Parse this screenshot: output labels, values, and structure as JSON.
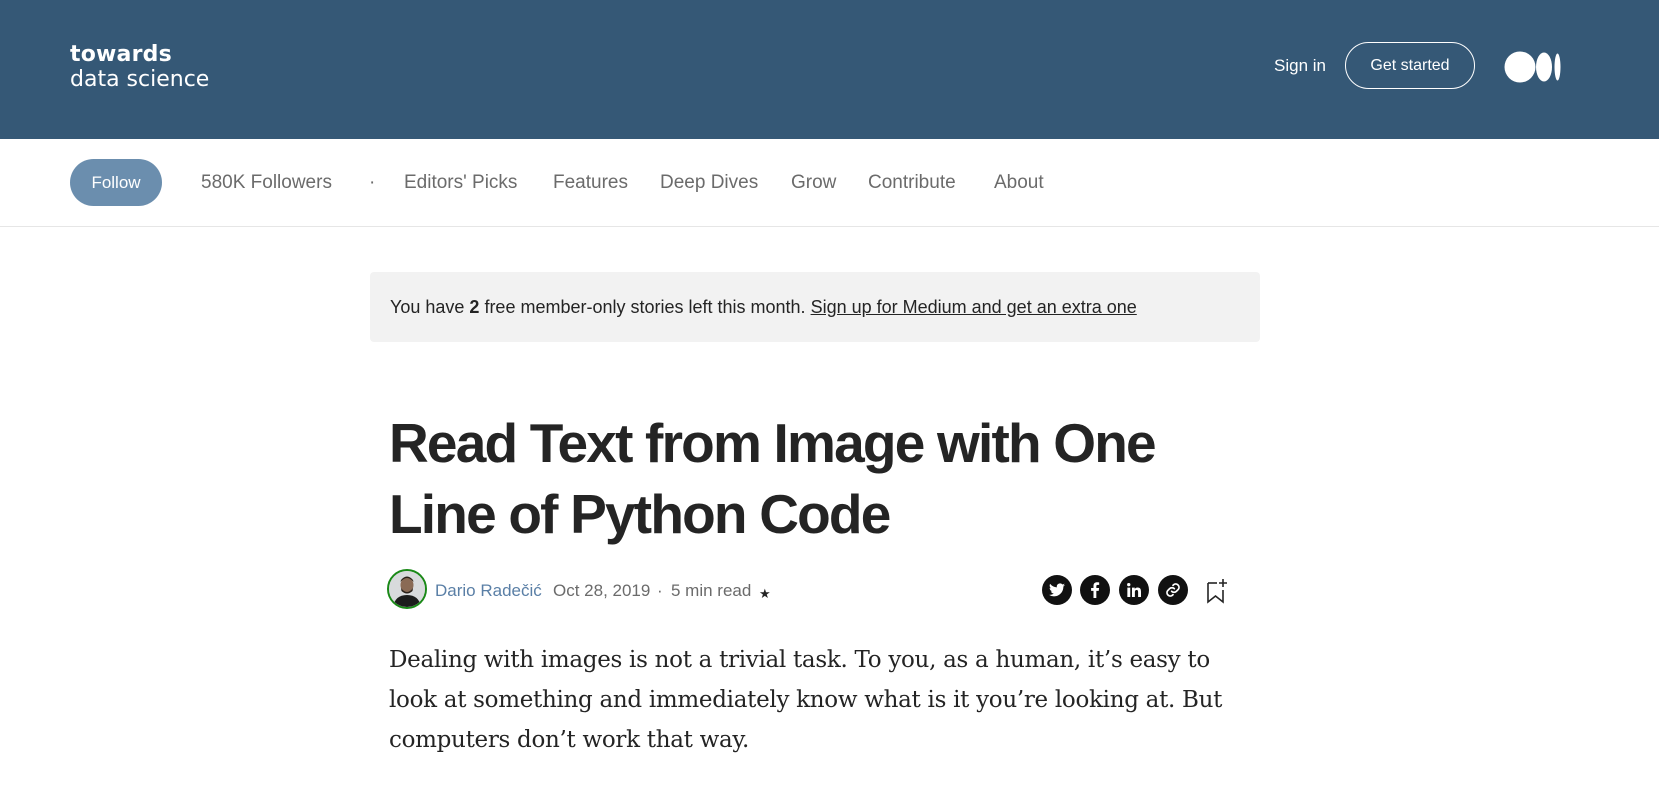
{
  "header": {
    "logo_line1": "towards",
    "logo_line2": "data science",
    "sign_in": "Sign in",
    "get_started": "Get started",
    "medium_icon": "medium-logo-icon"
  },
  "subnav": {
    "follow": "Follow",
    "followers": "580K Followers",
    "separator": "·",
    "items": [
      "Editors' Picks",
      "Features",
      "Deep Dives",
      "Grow",
      "Contribute",
      "About"
    ]
  },
  "banner": {
    "prefix": "You have ",
    "count": "2",
    "suffix": " free member-only stories left this month. ",
    "link": "Sign up for Medium and get an extra one"
  },
  "article": {
    "title": "Read Text from Image with One Line of Python Code",
    "author": "Dario Radečić",
    "date": "Oct 28, 2019",
    "dot": "·",
    "read_time": "5 min read",
    "star": "★",
    "share_icons": [
      "twitter-icon",
      "facebook-icon",
      "linkedin-icon",
      "link-icon"
    ],
    "bookmark_icon": "bookmark-add-icon",
    "body": "Dealing with images is not a trivial task. To you, as a human, it’s easy to look at something and immediately know what is it you’re looking at. But computers don’t work that way."
  },
  "colors": {
    "header_bg": "#355876",
    "follow_bg": "#6b8eae",
    "author": "#5a7fa6",
    "avatar_ring": "#1a8917"
  }
}
